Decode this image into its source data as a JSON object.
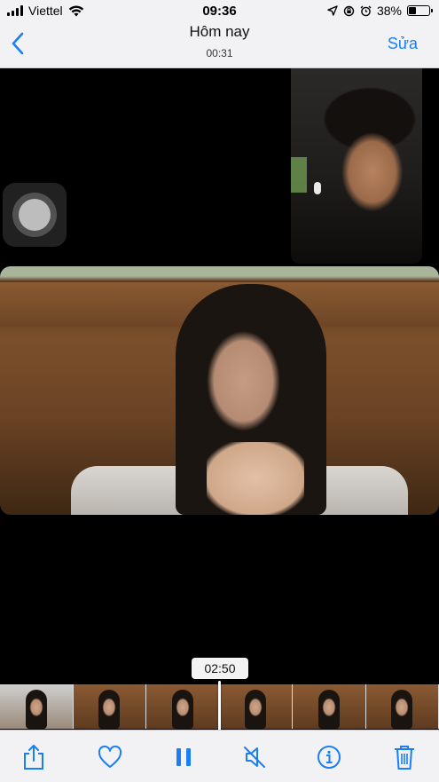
{
  "status_bar": {
    "carrier": "Viettel",
    "time": "09:36",
    "battery": "38%",
    "battery_level": 0.38
  },
  "nav": {
    "title": "Hôm nay",
    "subtitle": "00:31",
    "edit_label": "Sửa"
  },
  "video": {
    "current_time": "02:50"
  },
  "toolbar": {
    "icons": [
      "share-icon",
      "heart-icon",
      "pause-icon",
      "mute-icon",
      "info-icon",
      "trash-icon"
    ]
  },
  "colors": {
    "accent": "#1a7ff5",
    "bar_bg": "#f2f2f4"
  }
}
